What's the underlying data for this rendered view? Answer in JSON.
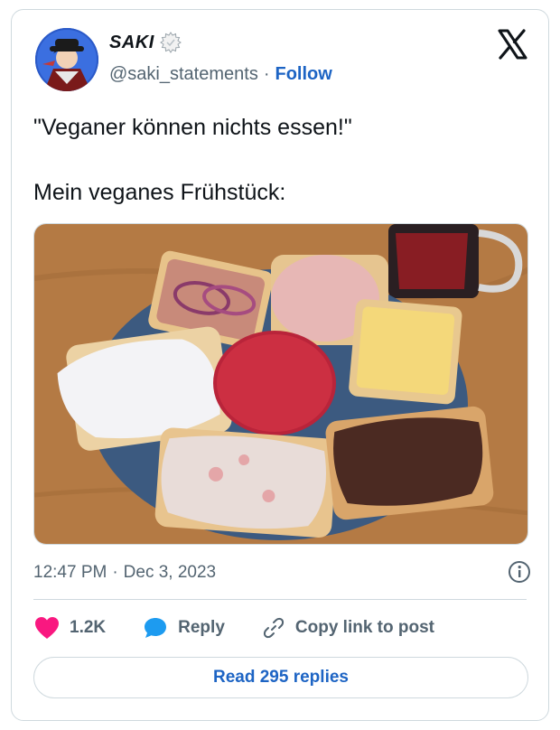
{
  "author": {
    "display_name": "SAKI",
    "handle": "@saki_statements",
    "follow_label": "Follow"
  },
  "tweet": {
    "lines": [
      "\"Veganer können nichts essen!\"",
      "Mein veganes Frühstück:"
    ],
    "time": "12:47 PM",
    "date": "Dec 3, 2023"
  },
  "actions": {
    "like_count": "1.2K",
    "reply_label": "Reply",
    "copy_link_label": "Copy link to post",
    "read_replies_label": "Read 295 replies"
  },
  "icons": {
    "logo": "x-logo-icon",
    "verified": "verified-badge-icon",
    "info": "info-icon",
    "like": "heart-icon",
    "reply": "speech-bubble-icon",
    "copy": "link-icon"
  },
  "colors": {
    "accent": "#1d64c4",
    "like": "#f91880",
    "muted": "#536471",
    "border": "#cfd9de"
  }
}
